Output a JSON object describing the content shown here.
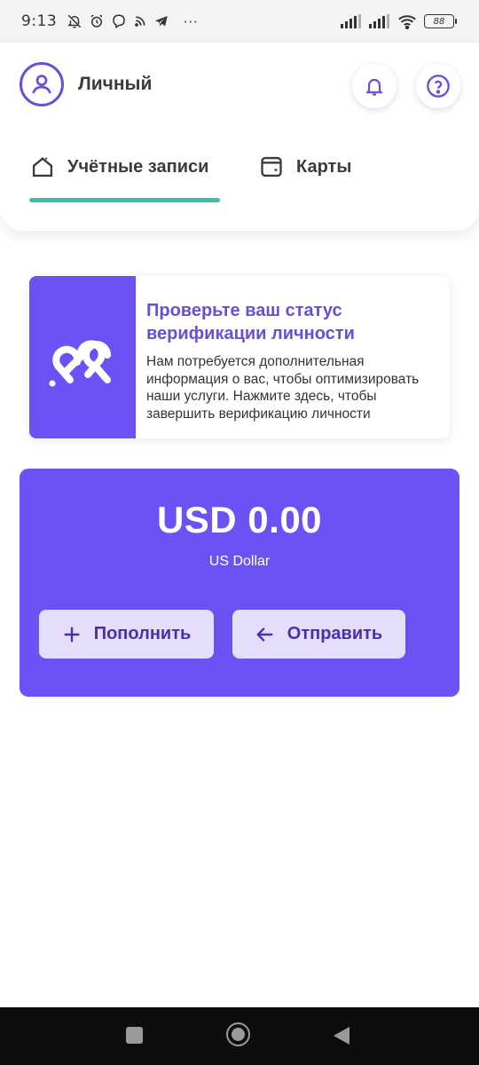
{
  "status_bar": {
    "time": "9:13",
    "more": "···",
    "battery": "88"
  },
  "header": {
    "profile_name": "Личный",
    "tabs": [
      {
        "label": "Учётные записи",
        "icon": "home-icon",
        "active": true
      },
      {
        "label": "Карты",
        "icon": "wallet-icon",
        "active": false
      }
    ]
  },
  "verification": {
    "title": "Проверьте ваш статус верификации личности",
    "description": "Нам потребуется дополнительная информация о вас, чтобы оптимизировать наши услуги. Нажмите здесь, чтобы завершить верификацию личности"
  },
  "balance": {
    "amount": "USD 0.00",
    "currency": "US Dollar",
    "topup_label": "Пополнить",
    "send_label": "Отправить"
  },
  "colors": {
    "accent": "#6b52f5",
    "title_purple": "#6a4fd6",
    "tab_indicator": "#3dbfae",
    "button_bg": "#e4defb",
    "button_text": "#4b2fae"
  }
}
